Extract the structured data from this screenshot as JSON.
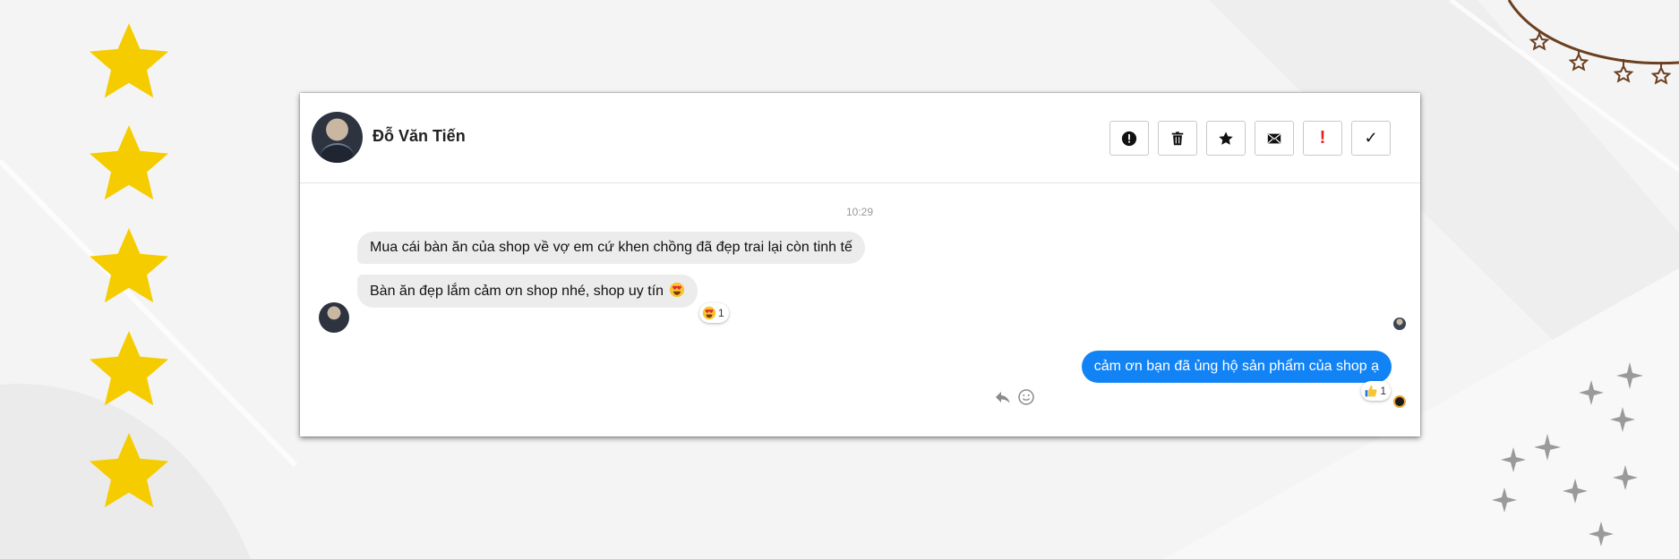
{
  "contact": {
    "name": "Đỗ Văn Tiến"
  },
  "toolbar": {
    "buttons": [
      {
        "icon": "alert-circle-icon"
      },
      {
        "icon": "trash-icon"
      },
      {
        "icon": "star-icon"
      },
      {
        "icon": "mail-icon"
      },
      {
        "icon": "exclamation-icon",
        "label": "!"
      },
      {
        "icon": "check-icon",
        "label": "✓"
      }
    ]
  },
  "conversation": {
    "timestamp": "10:29",
    "messages": [
      {
        "direction": "in",
        "text": "Mua cái bàn ăn của shop về vợ em cứ khen chồng đã đẹp trai lại còn tinh tế"
      },
      {
        "direction": "in",
        "text": "Bàn ăn đẹp lắm cảm ơn shop nhé, shop uy tín",
        "emoji": "heart-eyes-emoji",
        "reaction": {
          "emoji": "heart-eyes-emoji",
          "count": "1"
        }
      },
      {
        "direction": "out",
        "text": "cảm ơn bạn đã ủng hộ sản phẩm của shop ạ",
        "reaction": {
          "emoji": "thumbs-up-emoji",
          "count": "1"
        }
      }
    ]
  },
  "colors": {
    "outgoing_bubble": "#1283f5",
    "incoming_bubble": "#ececec",
    "star": "#f5cc00",
    "alert_red": "#e02424"
  }
}
